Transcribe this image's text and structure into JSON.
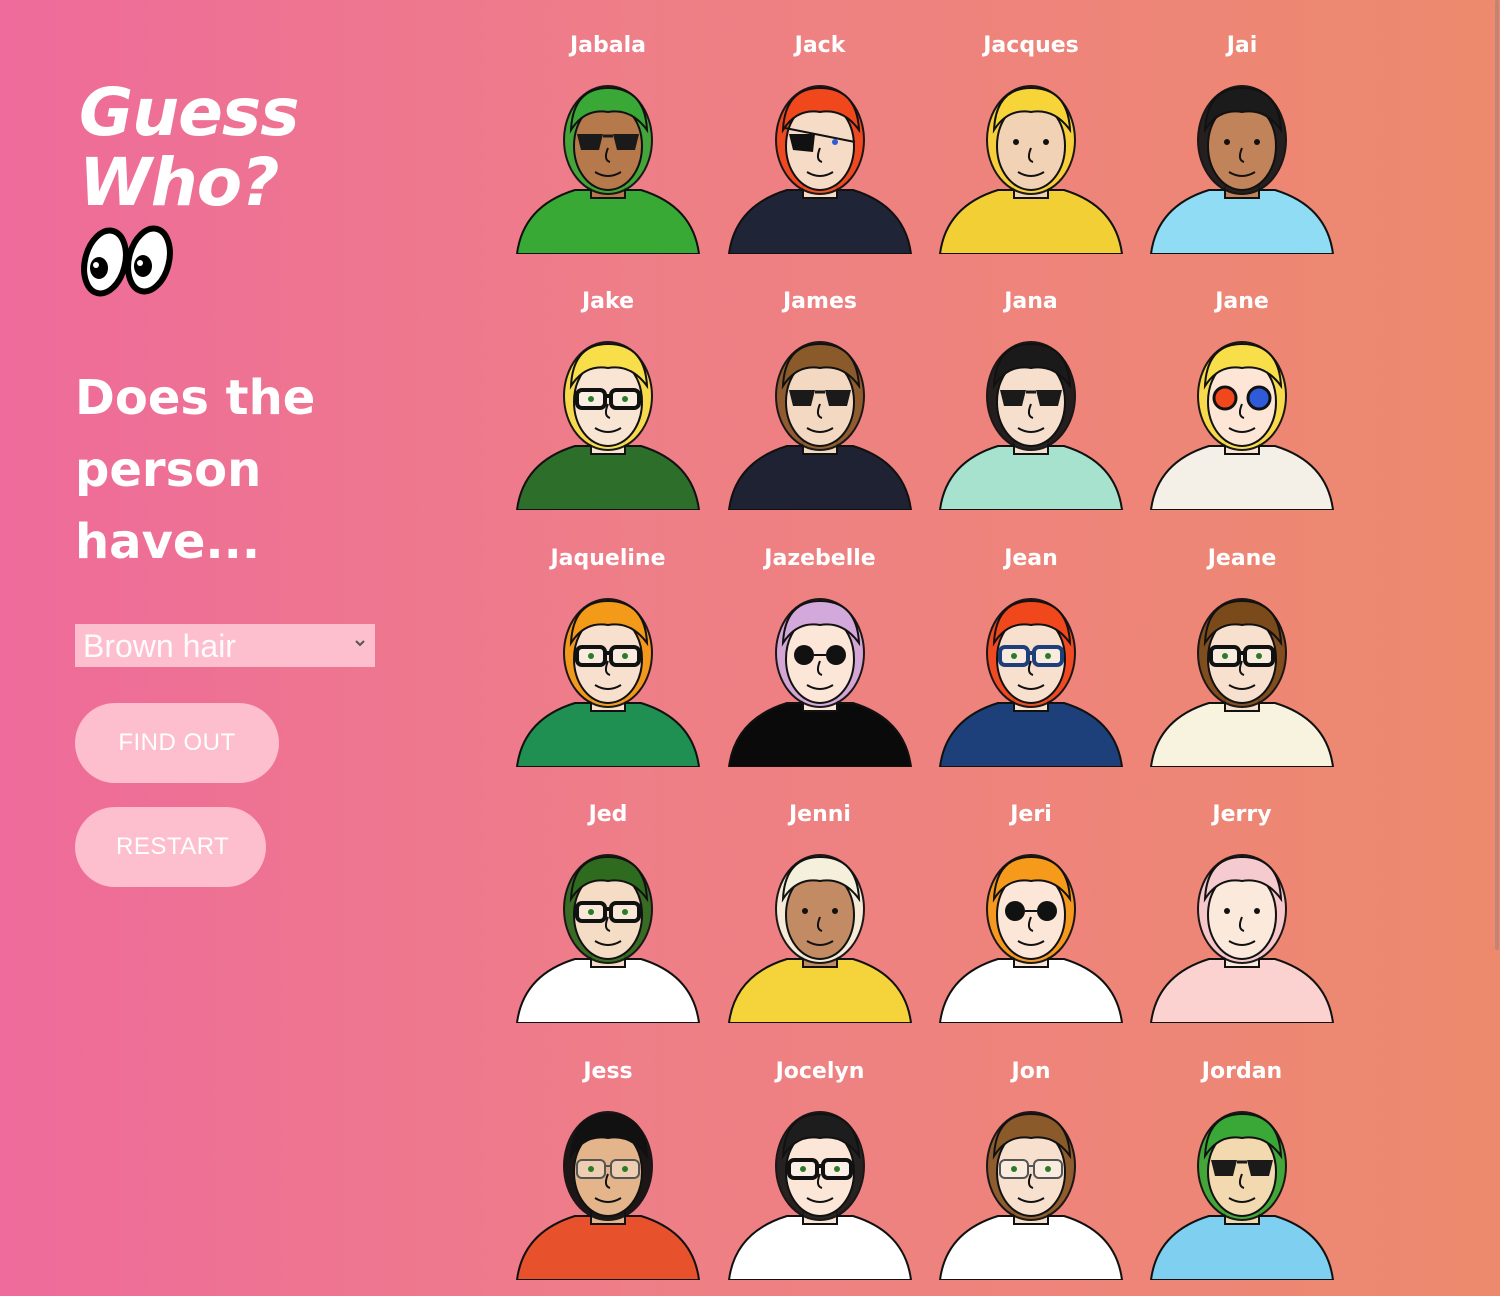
{
  "logo": {
    "line1": "Guess",
    "line2": "Who?"
  },
  "question": "Does the person have...",
  "select": {
    "selected": "Brown hair"
  },
  "buttons": {
    "find_out": "FIND OUT",
    "restart": "RESTART"
  },
  "characters": [
    {
      "name": "Jabala",
      "hair": "#3aa836",
      "skin": "#b5794c",
      "shirt": "#38a935",
      "glasses": "sun"
    },
    {
      "name": "Jack",
      "hair": "#f0471d",
      "skin": "#f6dcc6",
      "shirt": "#1f2437",
      "glasses": "patch"
    },
    {
      "name": "Jacques",
      "hair": "#f7d438",
      "skin": "#f1d2b5",
      "shirt": "#f2cf34",
      "glasses": "none"
    },
    {
      "name": "Jai",
      "hair": "#1b1b1b",
      "skin": "#c18359",
      "shirt": "#8fdcf4",
      "glasses": "none"
    },
    {
      "name": "Jake",
      "hair": "#f8df4a",
      "skin": "#f9e5d4",
      "shirt": "#2c6e2a",
      "glasses": "black"
    },
    {
      "name": "James",
      "hair": "#8a5a2b",
      "skin": "#f3d8c2",
      "shirt": "#1f2233",
      "glasses": "sun"
    },
    {
      "name": "Jana",
      "hair": "#1a1a1a",
      "skin": "#f6dfcd",
      "shirt": "#a7e2cf",
      "glasses": "sun"
    },
    {
      "name": "Jane",
      "hair": "#f8df4a",
      "skin": "#fde6d6",
      "shirt": "#f4f0e8",
      "glasses": "color"
    },
    {
      "name": "Jaqueline",
      "hair": "#f39a18",
      "skin": "#f8e0ce",
      "shirt": "#1f8f52",
      "glasses": "black"
    },
    {
      "name": "Jazebelle",
      "hair": "#d3a8da",
      "skin": "#fbe6d8",
      "shirt": "#0a0a0a",
      "glasses": "round"
    },
    {
      "name": "Jean",
      "hair": "#f0471d",
      "skin": "#f8e0ce",
      "shirt": "#1d3f7a",
      "glasses": "blue"
    },
    {
      "name": "Jeane",
      "hair": "#7a4a1a",
      "skin": "#f8e0ce",
      "shirt": "#f8f3df",
      "glasses": "black"
    },
    {
      "name": "Jed",
      "hair": "#2f6b1e",
      "skin": "#f5dcc4",
      "shirt": "#ffffff",
      "glasses": "black"
    },
    {
      "name": "Jenni",
      "hair": "#f5f0dc",
      "skin": "#c28b63",
      "shirt": "#f4d43a",
      "glasses": "none"
    },
    {
      "name": "Jeri",
      "hair": "#f59a1b",
      "skin": "#fbe6d8",
      "shirt": "#ffffff",
      "glasses": "round"
    },
    {
      "name": "Jerry",
      "hair": "#f6cbd0",
      "skin": "#fbe9dc",
      "shirt": "#fbd2cf",
      "glasses": "none"
    },
    {
      "name": "Jess",
      "hair": "#111111",
      "skin": "#e4b48a",
      "shirt": "#e7512b",
      "glasses": "thin"
    },
    {
      "name": "Jocelyn",
      "hair": "#1d1d1d",
      "skin": "#fbe6d8",
      "shirt": "#ffffff",
      "glasses": "black"
    },
    {
      "name": "Jon",
      "hair": "#8a5a2b",
      "skin": "#f8e0ce",
      "shirt": "#ffffff",
      "glasses": "thin"
    },
    {
      "name": "Jordan",
      "hair": "#3aa836",
      "skin": "#f3d9b0",
      "shirt": "#7fd0f0",
      "glasses": "sun"
    }
  ]
}
